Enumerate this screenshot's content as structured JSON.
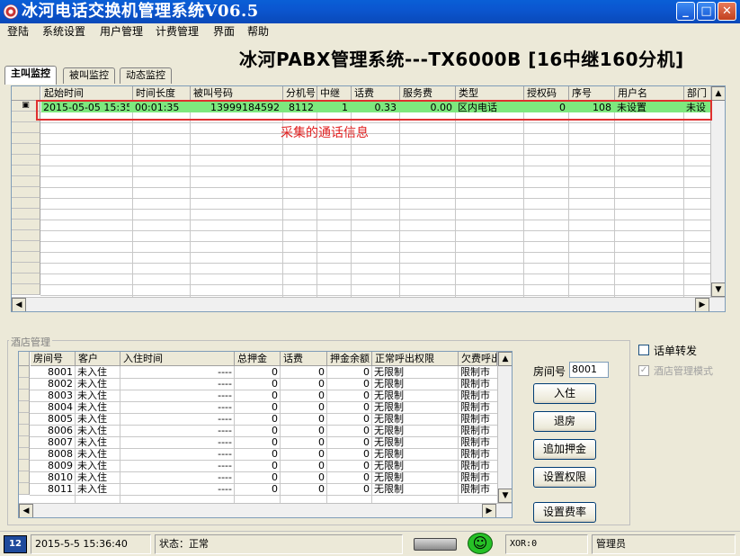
{
  "window": {
    "title": "冰河电话交换机管理系统V06.5"
  },
  "menu": [
    "登陆",
    "系统设置",
    "用户管理",
    "计费管理",
    "界面",
    "帮助"
  ],
  "banner": "冰河PABX管理系统---TX6000B  [16中继160分机]",
  "tabs": [
    "主叫监控",
    "被叫监控",
    "动态监控"
  ],
  "calls": {
    "columns": [
      "起始时间",
      "时间长度",
      "被叫号码",
      "分机号",
      "中继",
      "话费",
      "服务费",
      "类型",
      "授权码",
      "序号",
      "用户名",
      "部门"
    ],
    "row": [
      "2015-05-05 15:35",
      "00:01:35",
      "13999184592",
      "8112",
      "1",
      "0.33",
      "0.00",
      "区内电话",
      "0",
      "108",
      "未设置",
      "未设"
    ],
    "row_marker": "▣"
  },
  "annotation": "采集的通话信息",
  "hotel": {
    "title": "酒店管理",
    "columns": [
      "房间号",
      "客户",
      "入住时间",
      "总押金",
      "话费",
      "押金余额",
      "正常呼出权限",
      "欠费呼出"
    ],
    "rows": [
      [
        "8001",
        "未入住",
        "----",
        "0",
        "0",
        "0",
        "无限制",
        "限制市"
      ],
      [
        "8002",
        "未入住",
        "----",
        "0",
        "0",
        "0",
        "无限制",
        "限制市"
      ],
      [
        "8003",
        "未入住",
        "----",
        "0",
        "0",
        "0",
        "无限制",
        "限制市"
      ],
      [
        "8004",
        "未入住",
        "----",
        "0",
        "0",
        "0",
        "无限制",
        "限制市"
      ],
      [
        "8005",
        "未入住",
        "----",
        "0",
        "0",
        "0",
        "无限制",
        "限制市"
      ],
      [
        "8006",
        "未入住",
        "----",
        "0",
        "0",
        "0",
        "无限制",
        "限制市"
      ],
      [
        "8007",
        "未入住",
        "----",
        "0",
        "0",
        "0",
        "无限制",
        "限制市"
      ],
      [
        "8008",
        "未入住",
        "----",
        "0",
        "0",
        "0",
        "无限制",
        "限制市"
      ],
      [
        "8009",
        "未入住",
        "----",
        "0",
        "0",
        "0",
        "无限制",
        "限制市"
      ],
      [
        "8010",
        "未入住",
        "----",
        "0",
        "0",
        "0",
        "无限制",
        "限制市"
      ],
      [
        "8011",
        "未入住",
        "----",
        "0",
        "0",
        "0",
        "无限制",
        "限制市"
      ]
    ],
    "room_label": "房间号",
    "room_value": "8001",
    "buttons": [
      "入住",
      "退房",
      "追加押金",
      "设置权限",
      "设置费率"
    ],
    "checkbox_forward": "话单转发",
    "checkbox_hotel_mode": "酒店管理模式"
  },
  "status": {
    "datetime": "2015-5-5 15:36:40",
    "state": "状态：正常",
    "xor": "XOR:0",
    "user": "管理员",
    "calendar_icon_text": "12"
  },
  "colors": {
    "highlight": "#7ee87e",
    "annotation": "#e02020",
    "titlebar": "#0a5fd6"
  }
}
